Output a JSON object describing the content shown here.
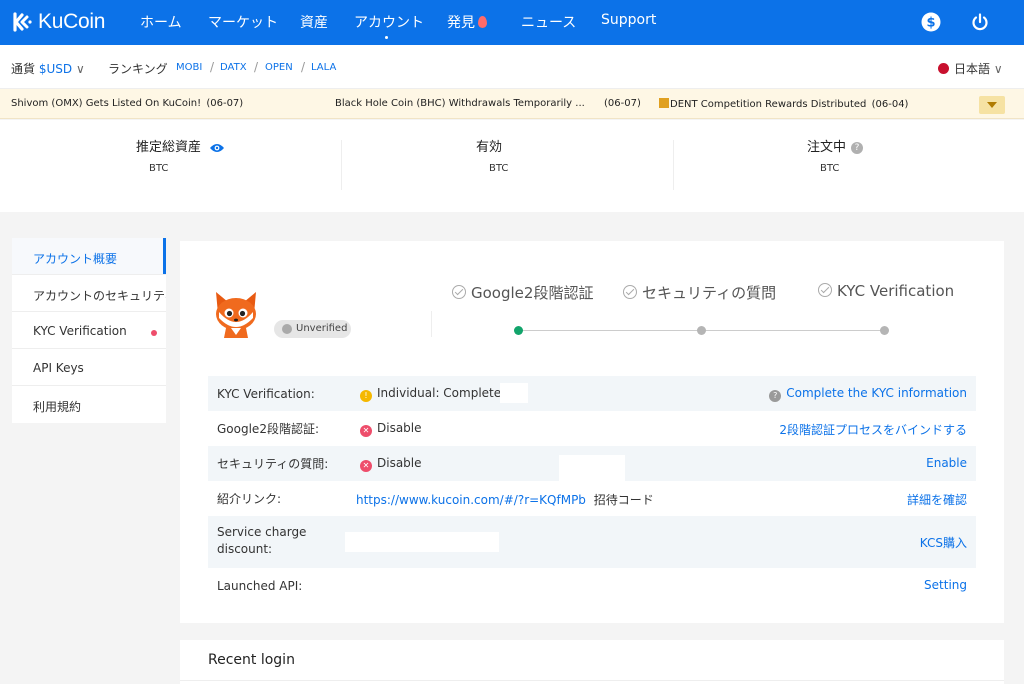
{
  "nav": {
    "logo": "KuCoin",
    "items": [
      "ホーム",
      "マーケット",
      "資産",
      "アカウント",
      "発見",
      "ニュース",
      "Support"
    ],
    "icons": [
      "dollar-icon",
      "power-icon"
    ]
  },
  "subbar": {
    "currency_label": "通貨",
    "currency_value": "$USD",
    "ranking_label": "ランキング",
    "ranking": [
      "MOBI",
      "DATX",
      "OPEN",
      "LALA"
    ],
    "language": "日本語"
  },
  "announcements": [
    {
      "text": "Shivom (OMX) Gets Listed On KuCoin!",
      "date": "(06-07)"
    },
    {
      "text": "Black Hole Coin (BHC) Withdrawals Temporarily ...",
      "date": "(06-07)"
    },
    {
      "text": "DENT Competition Rewards Distributed",
      "date": "(06-04)"
    }
  ],
  "balance": {
    "total_label": "推定総資産",
    "total_unit": "BTC",
    "available_label": "有効",
    "available_unit": "BTC",
    "order_label": "注文中",
    "order_unit": "BTC"
  },
  "sidebar": {
    "items": [
      "アカウント概要",
      "アカウントのセキュリティ",
      "KYC Verification",
      "API Keys",
      "利用規約"
    ]
  },
  "profile": {
    "status": "Unverified",
    "steps": [
      "Google2段階認証",
      "セキュリティの質問",
      "KYC Verification"
    ],
    "completed_steps": 0
  },
  "account_rows": [
    {
      "key": "KYC Verification:",
      "value": "Individual: Completed",
      "action": "Complete the KYC information"
    },
    {
      "key": "Google2段階認証:",
      "value": "Disable",
      "action": "2段階認証プロセスをバインドする"
    },
    {
      "key": "セキュリティの質問:",
      "value": "Disable",
      "action": "Enable"
    },
    {
      "key": "紹介リンク:",
      "value": "https://www.kucoin.com/#/?r=KQfMPb",
      "extra": "招待コード",
      "action": "詳細を確認"
    },
    {
      "key": "Service charge discount:",
      "value": "",
      "action": "KCS購入"
    },
    {
      "key": "Launched API:",
      "value": "",
      "action": "Setting"
    }
  ],
  "recent_login": {
    "title": "Recent login"
  },
  "colors": {
    "brand": "#0c72e8",
    "success": "#12a46b",
    "warning": "#f5b800",
    "danger": "#ee4d6b"
  }
}
